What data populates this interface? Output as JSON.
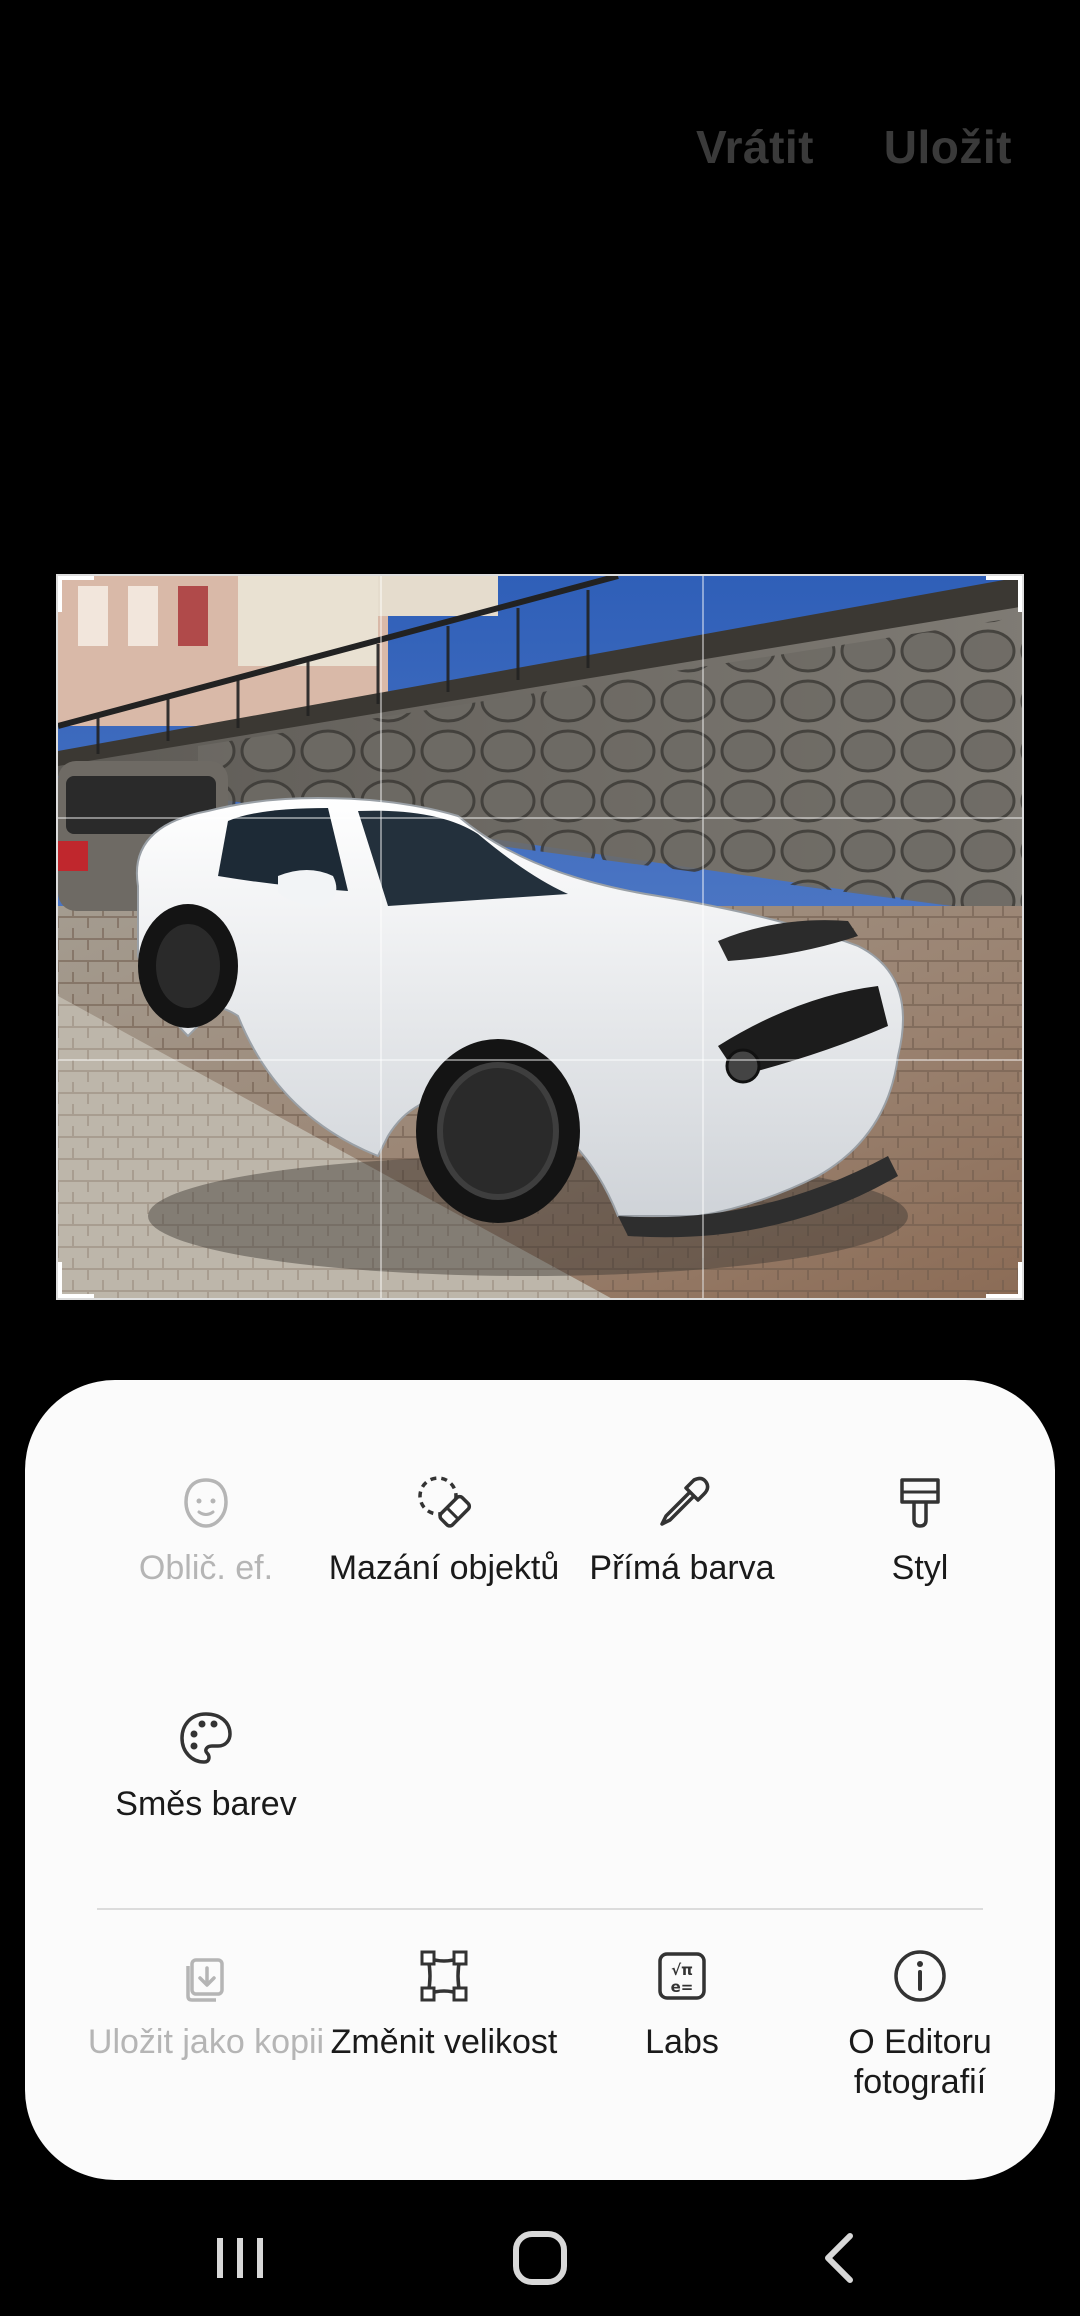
{
  "header": {
    "revert_label": "Vrátit",
    "save_label": "Uložit"
  },
  "tools": [
    {
      "label": "Oblič. ef.",
      "icon": "face-icon",
      "enabled": false
    },
    {
      "label": "Mazání objektů",
      "icon": "eraser-icon",
      "enabled": true
    },
    {
      "label": "Přímá barva",
      "icon": "eyedropper-icon",
      "enabled": true
    },
    {
      "label": "Styl",
      "icon": "brush-icon",
      "enabled": true
    },
    {
      "label": "Směs barev",
      "icon": "palette-icon",
      "enabled": true
    }
  ],
  "more": [
    {
      "label": "Uložit jako kopii",
      "icon": "save-copy-icon",
      "enabled": false
    },
    {
      "label": "Změnit velikost",
      "icon": "resize-icon",
      "enabled": true
    },
    {
      "label": "Labs",
      "icon": "labs-icon",
      "enabled": true
    },
    {
      "label": "O Editoru fotografií",
      "icon": "info-icon",
      "enabled": true
    }
  ],
  "nav": {
    "recents": "recents-icon",
    "home": "home-icon",
    "back": "back-icon"
  },
  "colors": {
    "background": "#000000",
    "sheet": "#fbfbfb",
    "text": "#1a1a1a",
    "disabled": "#b5b5b5",
    "header_buttons": "#3a3a3a"
  }
}
